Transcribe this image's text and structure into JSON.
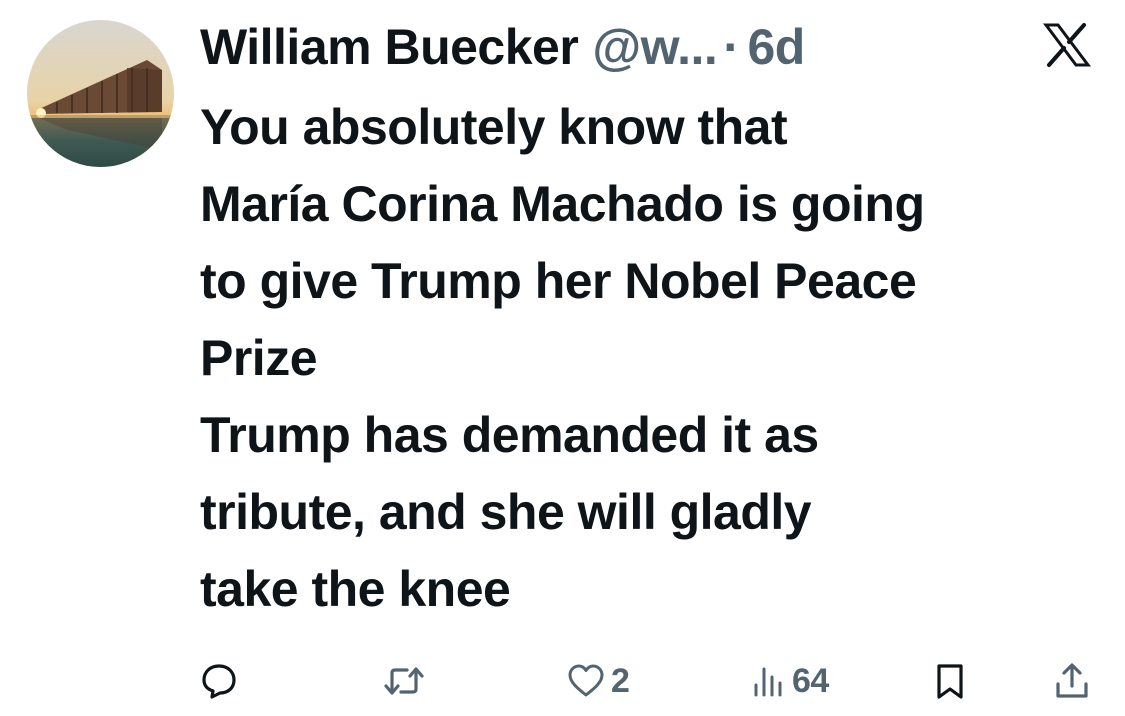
{
  "tweet": {
    "author_name": "William Buecker",
    "handle": "@w...",
    "separator": "·",
    "time": "6d",
    "text": "You absolutely know that\nMaría Corina Machado is going\nto give Trump her Nobel Peace\nPrize\nTrump has demanded it as\ntribute, and she will gladly\ntake the knee"
  },
  "actions": {
    "reply": {
      "icon": "reply-icon",
      "count": ""
    },
    "retweet": {
      "icon": "retweet-icon",
      "count": ""
    },
    "like": {
      "icon": "heart-icon",
      "count": "2"
    },
    "views": {
      "icon": "views-icon",
      "count": "64"
    },
    "bookmark": {
      "icon": "bookmark-icon"
    },
    "share": {
      "icon": "share-icon"
    }
  },
  "colors": {
    "text_primary": "#0f1419",
    "text_secondary": "#536471",
    "background": "#ffffff"
  }
}
